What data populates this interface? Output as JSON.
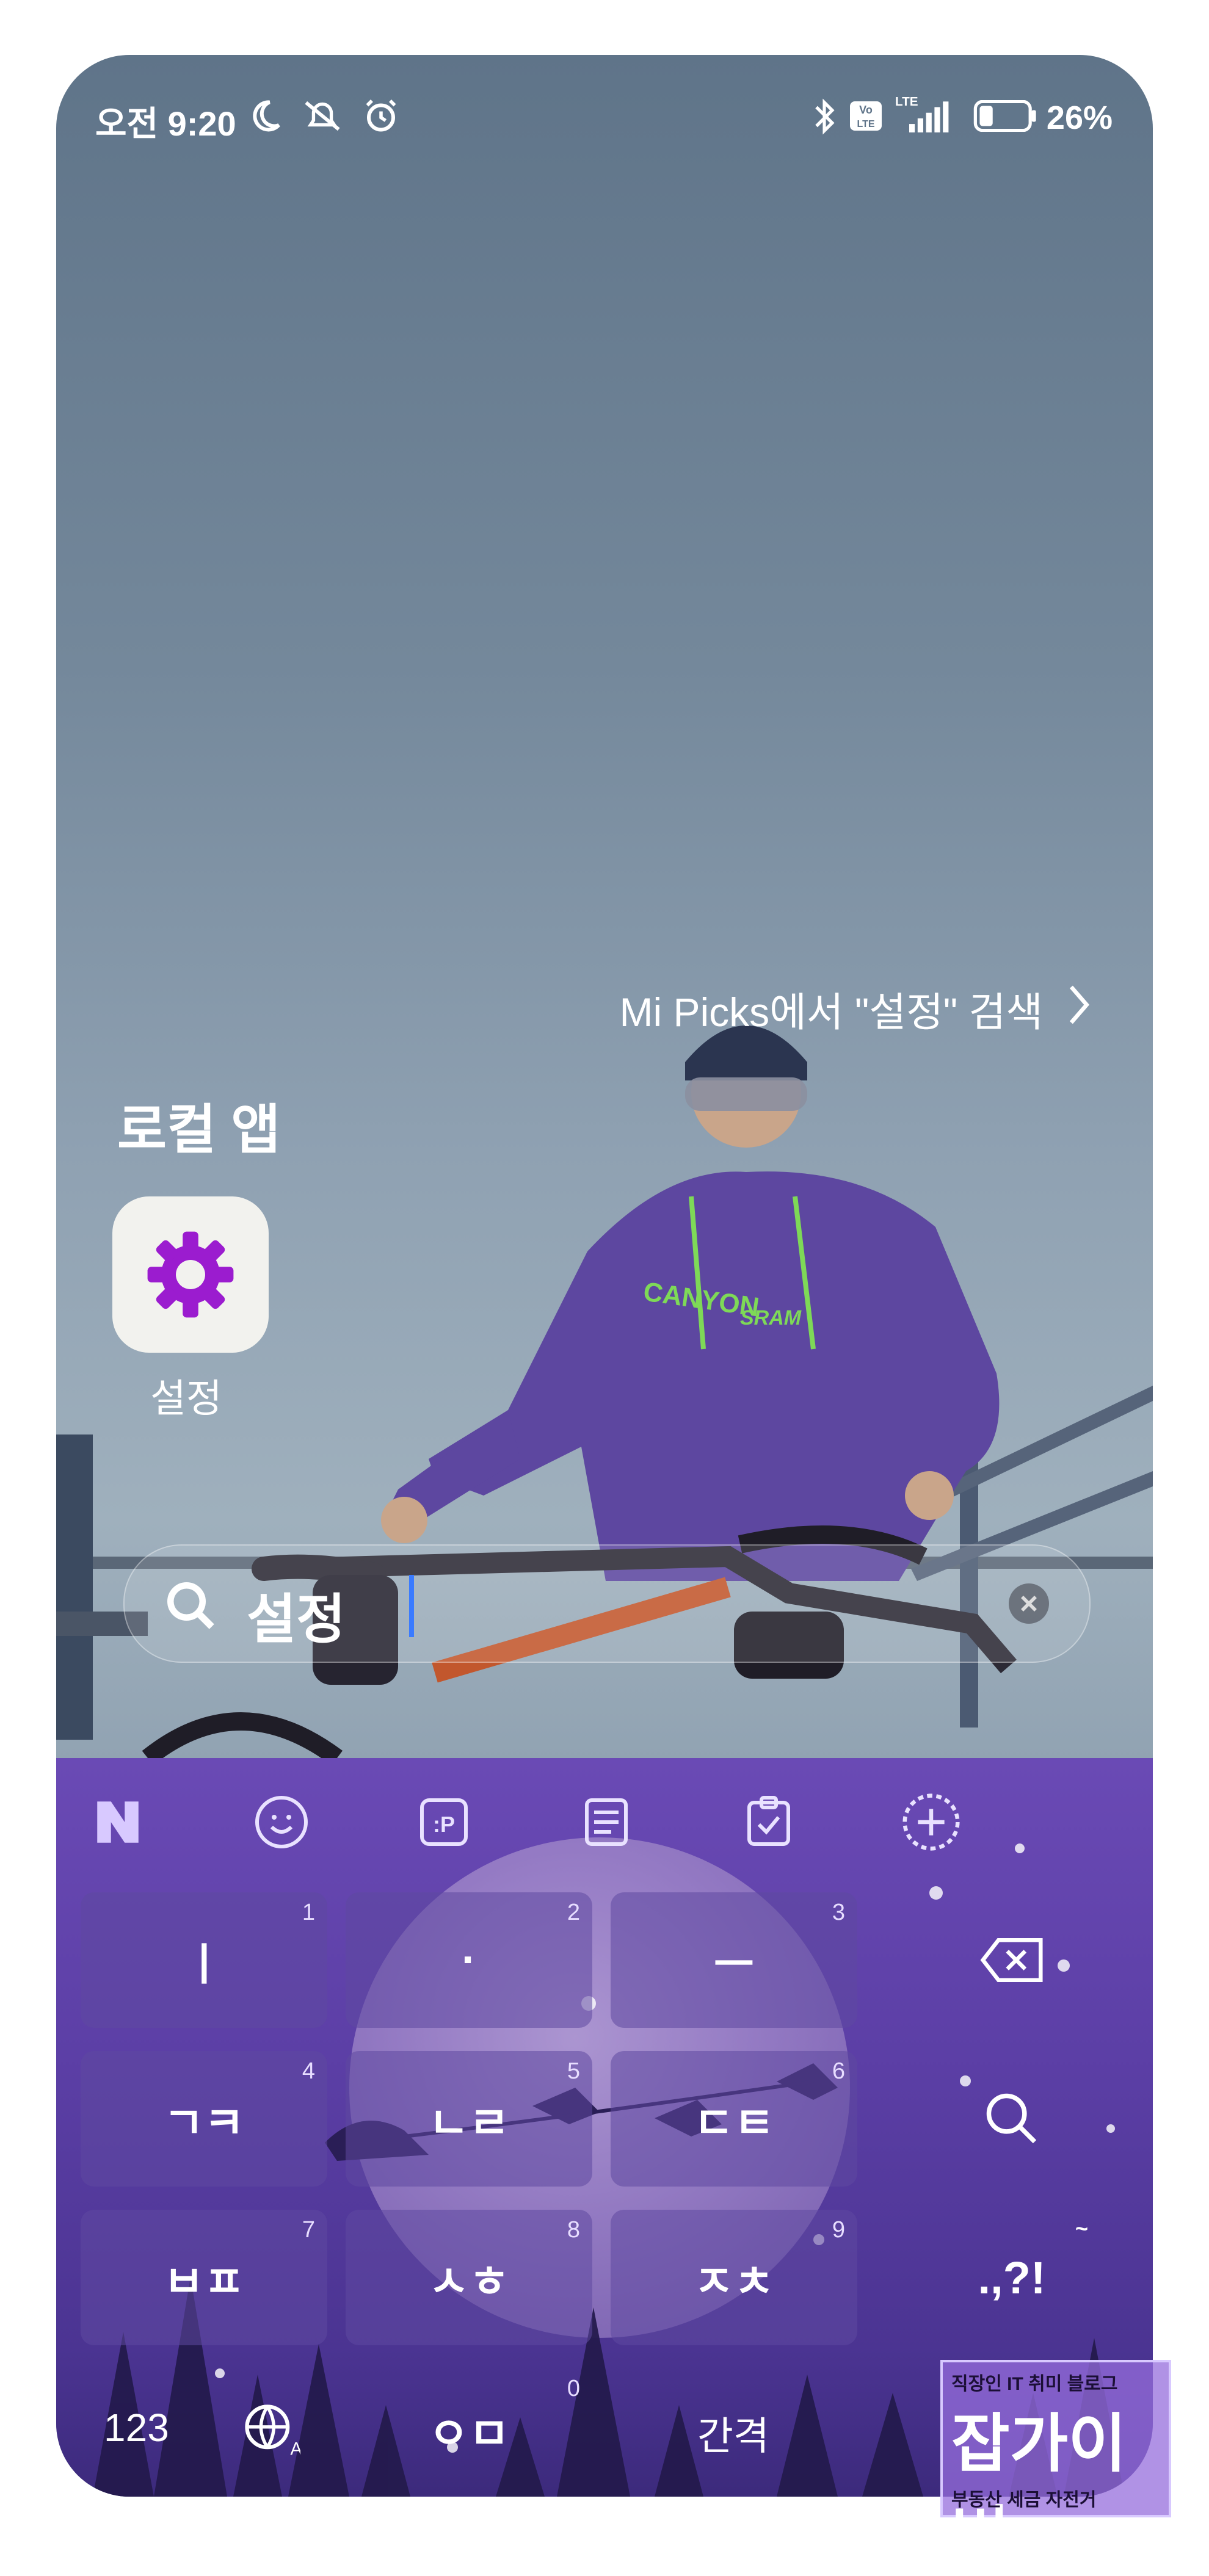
{
  "status_bar": {
    "time": "오전 9:20",
    "battery": "26%",
    "network": "LTE",
    "volte": "Vo LTE"
  },
  "search_suggestions": {
    "mi_picks": "Mi Picks에서 \"설정\" 검색"
  },
  "local_apps": {
    "title": "로컬 앱",
    "apps": [
      {
        "label": "설정",
        "icon": "gear-icon"
      }
    ]
  },
  "search": {
    "query": "설정"
  },
  "keyboard": {
    "keys": [
      {
        "label": "ㅣ",
        "num": "1"
      },
      {
        "label": "·",
        "num": "2"
      },
      {
        "label": "ㅡ",
        "num": "3"
      },
      {
        "label": "ㄱㅋ",
        "num": "4"
      },
      {
        "label": "ㄴㄹ",
        "num": "5"
      },
      {
        "label": "ㄷㅌ",
        "num": "6"
      },
      {
        "label": "ㅂㅍ",
        "num": "7"
      },
      {
        "label": "ㅅㅎ",
        "num": "8"
      },
      {
        "label": "ㅈㅊ",
        "num": "9"
      },
      {
        "label": "ㅇㅁ",
        "num": "0"
      }
    ],
    "punct": ".,?!",
    "tilde": "~",
    "mode_123": "123",
    "space": "간격",
    "colors": {
      "accent": "#6a4ab5"
    }
  },
  "watermark": {
    "line1": "직장인 IT 취미 블로그",
    "line2": "잡가이버",
    "line3": "부동산 세금 자전거"
  }
}
